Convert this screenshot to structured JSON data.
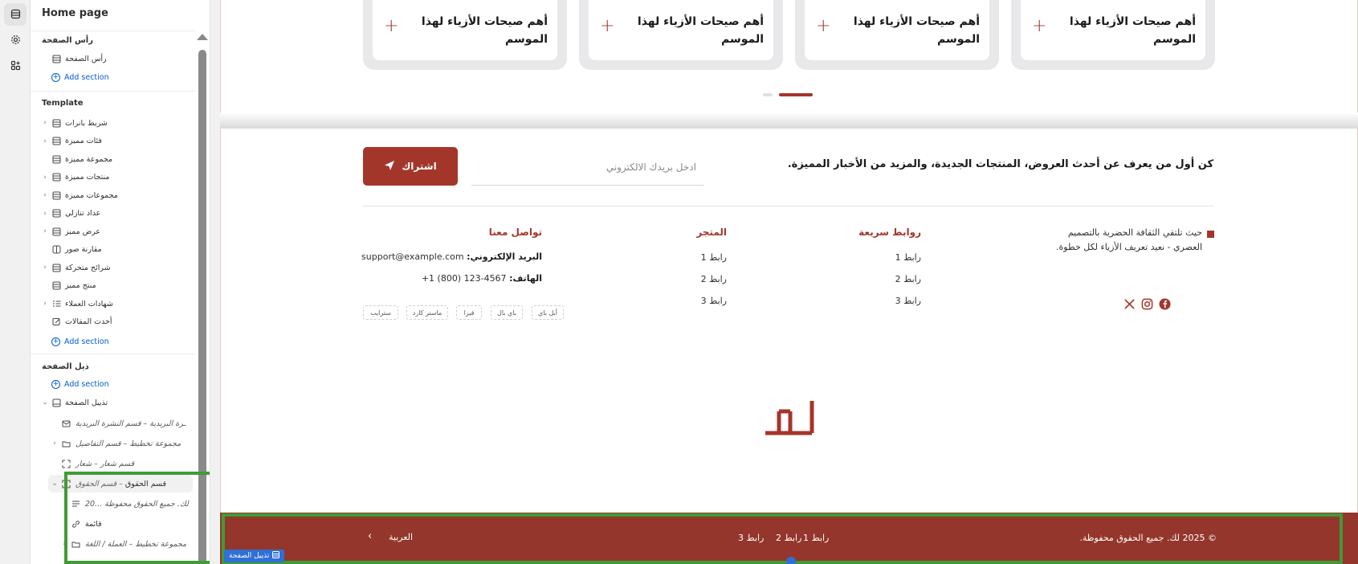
{
  "sidebar": {
    "title": "Home page",
    "header_group": {
      "heading": "رأس الصفحة",
      "items": [
        {
          "label": "رأس الصفحة",
          "icon": "section-icon"
        }
      ],
      "add_label": "Add section"
    },
    "template_group": {
      "heading": "Template",
      "items": [
        {
          "label": "شريط بانرات",
          "icon": "section-icon",
          "expandable": true
        },
        {
          "label": "فئات مميزة",
          "icon": "section-icon",
          "expandable": true
        },
        {
          "label": "مجموعة مميزة",
          "icon": "section-icon",
          "expandable": false
        },
        {
          "label": "منتجات مميزة",
          "icon": "section-icon",
          "expandable": true
        },
        {
          "label": "مجموعات مميزة",
          "icon": "section-icon",
          "expandable": true
        },
        {
          "label": "عداد تنازلي",
          "icon": "section-icon",
          "expandable": true
        },
        {
          "label": "عرض مميز",
          "icon": "section-icon",
          "expandable": true
        },
        {
          "label": "مقارنة صور",
          "icon": "compare-icon",
          "expandable": false
        },
        {
          "label": "شرائح متحركة",
          "icon": "section-icon",
          "expandable": true
        },
        {
          "label": "منتج مميز",
          "icon": "section-icon",
          "expandable": false
        },
        {
          "label": "شهادات العملاء",
          "icon": "list-icon",
          "expandable": true
        },
        {
          "label": "أحدث المقالات",
          "icon": "blog-icon",
          "expandable": false
        }
      ],
      "add_label": "Add section"
    },
    "footer_group": {
      "heading": "ذيل الصفحة",
      "add_label": "Add section",
      "footer_label": "تذييل الصفحة",
      "children": {
        "newsletter": "ـرة البريدية – قسم النشرة البريدية",
        "layout_details": "مجموعة تخطيط – قسم التفاصيل",
        "logo_section": "قسم شعار – شعار",
        "rights_section_name": "قسم الحقوق",
        "rights_section_sub": "– قسم الحقوق",
        "rights_text": "20... لك. جميع الحقوق محفوظة",
        "menu": "قائمة",
        "layout_currency": "مجموعة تخطيط – العملة / اللغة"
      }
    }
  },
  "preview": {
    "cards": [
      {
        "title": "أهم صيحات الأزياء لهذا الموسم"
      },
      {
        "title": "أهم صيحات الأزياء لهذا الموسم"
      },
      {
        "title": "أهم صيحات الأزياء لهذا الموسم"
      },
      {
        "title": "أهم صيحات الأزياء لهذا الموسم"
      }
    ],
    "newsletter": {
      "text": "كن أول من يعرف عن أحدث العروض، المنتجات الجديدة، والمزيد من الأخبار المميزة.",
      "email_placeholder": "ادخل بريدك الالكتروني",
      "subscribe_label": "اشتراك"
    },
    "about": {
      "text": "حيث تلتقي الثقافة الحضرية بالتصميم العصري - نعيد تعريف الأزياء لكل خطوة."
    },
    "quick_links": {
      "heading": "روابط سريعة",
      "links": [
        "رابط 1",
        "رابط 2",
        "رابط 3"
      ]
    },
    "store": {
      "heading": "المتجر",
      "links": [
        "رابط 1",
        "رابط 2",
        "رابط 3"
      ]
    },
    "contact": {
      "heading": "تواصل معنا",
      "email_label": "البريد الإلكتروني:",
      "email": "support@example.com",
      "phone_label": "الهاتف:",
      "phone": "+1 (800) 123-4567"
    },
    "payments": [
      "أبل باي",
      "باي بال",
      "فيزا",
      "ماستر كارد",
      "سترايب"
    ],
    "bottom_bar": {
      "copyright": "© 2025 لك. جميع الحقوق محفوظة.",
      "links": [
        "رابط 1",
        "رابط 2",
        "رابط 3"
      ],
      "language": "العربية",
      "section_tag": "تذييل الصفحة"
    }
  },
  "colors": {
    "brand": "#a3362a",
    "bottom_bar": "#94362b",
    "link_blue": "#005bd3",
    "selection_green": "#3f9c35"
  }
}
